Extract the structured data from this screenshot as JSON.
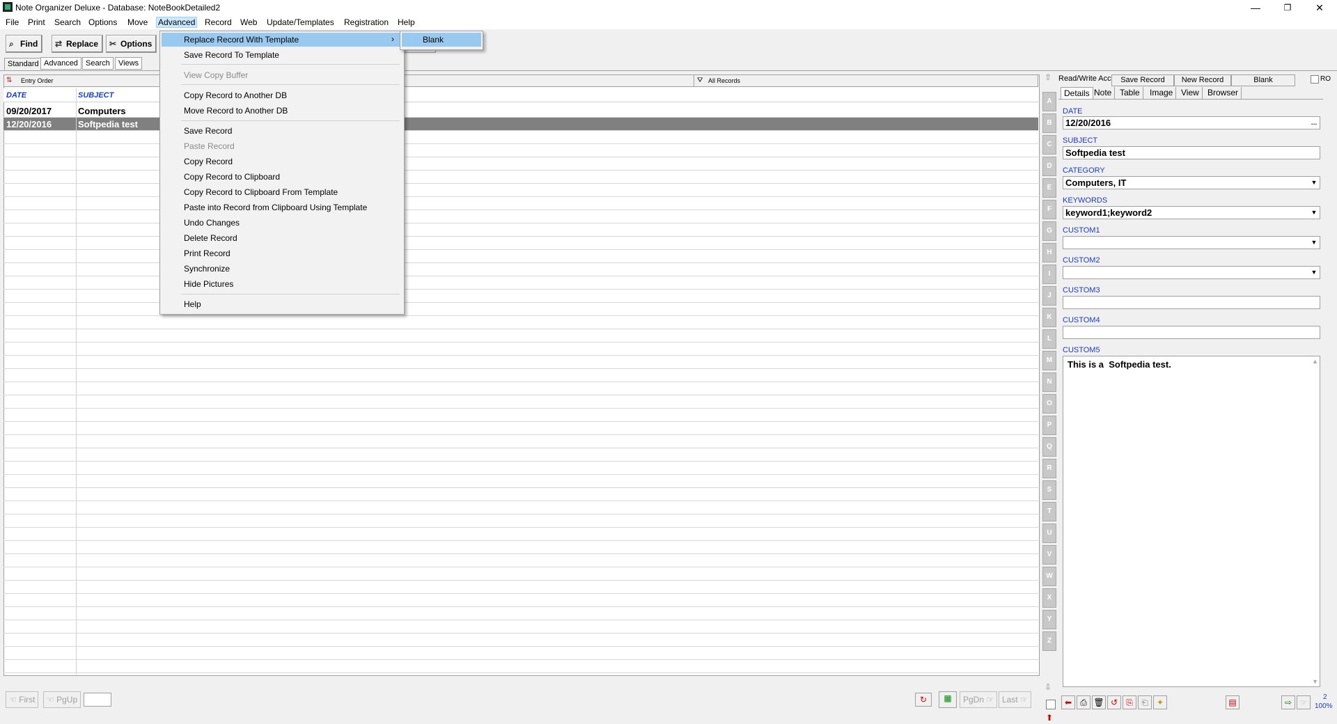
{
  "window": {
    "title": "Note Organizer Deluxe - Database: NoteBookDetailed2",
    "minimize": "—",
    "maximize": "❐",
    "close": "✕"
  },
  "menubar": [
    "File",
    "Print",
    "Search",
    "Options",
    "Move",
    "Advanced",
    "Record",
    "Web",
    "Update/Templates",
    "Registration",
    "Help"
  ],
  "toolbar": {
    "find": "Find",
    "replace": "Replace",
    "options": "Options",
    "subtabs": [
      "Standard",
      "Advanced",
      "Search",
      "Views"
    ]
  },
  "grid": {
    "order_label": "Entry Order",
    "filter_label": "All Records",
    "headers": [
      "DATE",
      "SUBJECT"
    ],
    "rows": [
      {
        "date": "09/20/2017",
        "subject": "Computers"
      },
      {
        "date": "12/20/2016",
        "subject": "Softpedia test"
      }
    ]
  },
  "alphabet": [
    "A",
    "B",
    "C",
    "D",
    "E",
    "F",
    "G",
    "H",
    "I",
    "J",
    "K",
    "L",
    "M",
    "N",
    "O",
    "P",
    "Q",
    "R",
    "S",
    "T",
    "U",
    "V",
    "W",
    "X",
    "Y",
    "Z"
  ],
  "record_panel": {
    "access": "Read/Write Access",
    "save_record": "Save Record",
    "new_record": "New Record",
    "blank": "Blank",
    "ro": "RO",
    "tabs": [
      "Details",
      "Note",
      "Table",
      "Image",
      "View",
      "Browser"
    ],
    "fields": {
      "date_label": "DATE",
      "date_value": "12/20/2016",
      "subject_label": "SUBJECT",
      "subject_value": "Softpedia test",
      "category_label": "CATEGORY",
      "category_value": "Computers, IT",
      "keywords_label": "KEYWORDS",
      "keywords_value": "keyword1;keyword2",
      "custom1_label": "CUSTOM1",
      "custom1_value": "",
      "custom2_label": "CUSTOM2",
      "custom2_value": "",
      "custom3_label": "CUSTOM3",
      "custom3_value": "",
      "custom4_label": "CUSTOM4",
      "custom4_value": "",
      "custom5_label": "CUSTOM5",
      "custom5_value": "This is a  Softpedia test."
    },
    "zoom_count": "2",
    "zoom": "100%"
  },
  "advanced_menu": {
    "items": [
      {
        "label": "Replace Record With Template",
        "enabled": true,
        "submenu": true,
        "highlight": true
      },
      {
        "label": "Save Record To Template",
        "enabled": true
      },
      {
        "label": "View Copy Buffer",
        "enabled": false
      },
      {
        "label": "Copy Record to Another DB",
        "enabled": true
      },
      {
        "label": "Move Record to Another DB",
        "enabled": true
      },
      {
        "label": "Save Record",
        "enabled": true
      },
      {
        "label": "Paste Record",
        "enabled": false
      },
      {
        "label": "Copy Record",
        "enabled": true
      },
      {
        "label": "Copy Record to Clipboard",
        "enabled": true
      },
      {
        "label": "Copy Record to Clipboard From Template",
        "enabled": true
      },
      {
        "label": "Paste into Record from Clipboard Using Template",
        "enabled": true
      },
      {
        "label": "Undo Changes",
        "enabled": true
      },
      {
        "label": "Delete Record",
        "enabled": true
      },
      {
        "label": "Print Record",
        "enabled": true
      },
      {
        "label": "Synchronize",
        "enabled": true
      },
      {
        "label": "Hide Pictures",
        "enabled": true
      },
      {
        "label": "Help",
        "enabled": true
      }
    ],
    "submenu_items": [
      "Blank"
    ]
  },
  "navigation": {
    "first": "First",
    "pgup": "PgUp",
    "page_value": "",
    "pgdn": "PgDn",
    "last": "Last"
  },
  "colors": {
    "highlight": "#99c9ef",
    "header_text": "#1a3ccc",
    "selected_row": "#808080"
  }
}
